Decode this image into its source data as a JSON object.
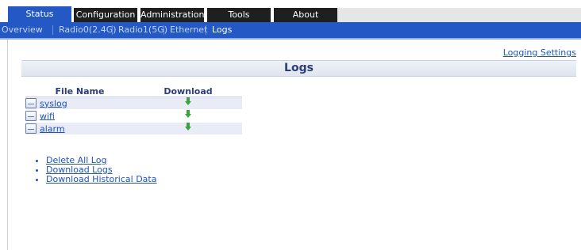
{
  "tabs": [
    {
      "label": "Status",
      "active": true
    },
    {
      "label": "Configuration",
      "active": false
    },
    {
      "label": "Administration",
      "active": false
    },
    {
      "label": "Tools",
      "active": false
    },
    {
      "label": "About",
      "active": false
    }
  ],
  "subnav": {
    "items": [
      "Overview",
      "Radio0(2.4G)",
      "Radio1(5G)",
      "Ethernet",
      "Logs"
    ],
    "current": "Logs"
  },
  "links": {
    "logging_settings": "Logging Settings"
  },
  "page_title": "Logs",
  "file_table": {
    "columns": [
      "File Name",
      "Download"
    ],
    "rows": [
      {
        "name": "syslog",
        "icon": "file-icon",
        "download_icon": "download-arrow-icon"
      },
      {
        "name": "wifi",
        "icon": "file-icon",
        "download_icon": "download-arrow-icon"
      },
      {
        "name": "alarm",
        "icon": "file-icon",
        "download_icon": "download-arrow-icon"
      }
    ]
  },
  "actions": [
    {
      "label": "Delete All Log"
    },
    {
      "label": "Download Logs"
    },
    {
      "label": "Download Historical Data"
    }
  ],
  "colors": {
    "nav_blue": "#2459c5",
    "tab_dark": "#1f1f1f",
    "link": "#1f52bf",
    "heading": "#2b3d7a",
    "row_alt": "#e9ebf7",
    "download_green": "#3aa33a"
  }
}
